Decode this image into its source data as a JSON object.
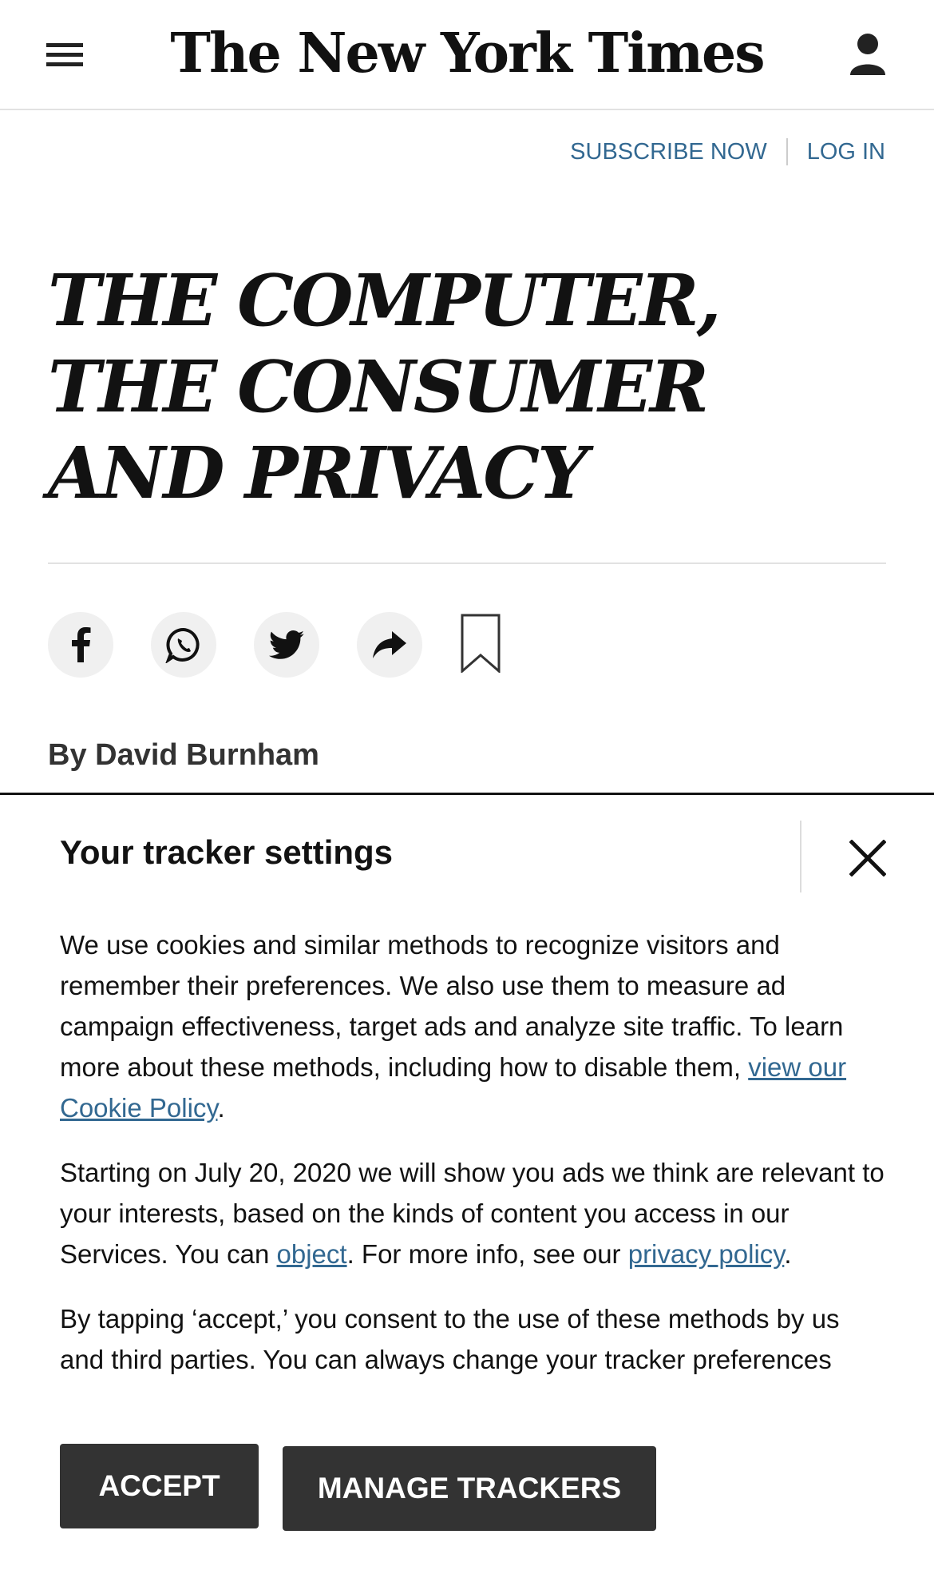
{
  "header": {
    "logo": "The New York Times",
    "menu_icon": "hamburger-menu-icon",
    "account_icon": "user-icon"
  },
  "subnav": {
    "subscribe": "SUBSCRIBE NOW",
    "login": "LOG IN"
  },
  "article": {
    "headline": "THE COMPUTER, THE CONSUMER AND PRIVACY",
    "byline": "By David Burnham",
    "share_icons": [
      "facebook-icon",
      "whatsapp-icon",
      "twitter-icon",
      "share-arrow-icon",
      "bookmark-icon"
    ]
  },
  "tracker": {
    "title": "Your tracker settings",
    "p1_text": "We use cookies and similar methods to recognize visitors and remember their preferences. We also use them to measure ad campaign effectiveness, target ads and analyze site traffic. To learn more about these methods, including how to disable them, ",
    "p1_link": "view our Cookie Policy",
    "p1_end": ".",
    "p2_text": "Starting on July 20, 2020 we will show you ads we think are relevant to your interests, based on the kinds of content you access in our Services. You can ",
    "p2_link1": "object",
    "p2_mid": ". For more info, see our ",
    "p2_link2": "privacy policy",
    "p2_end": ".",
    "p3_text": "By tapping ‘accept,’ you consent to the use of these methods by us and third parties. You can always change your tracker preferences",
    "accept_label": "ACCEPT",
    "manage_label": "MANAGE TRACKERS"
  },
  "colors": {
    "link": "#326891",
    "button": "#333333",
    "text": "#121212"
  }
}
